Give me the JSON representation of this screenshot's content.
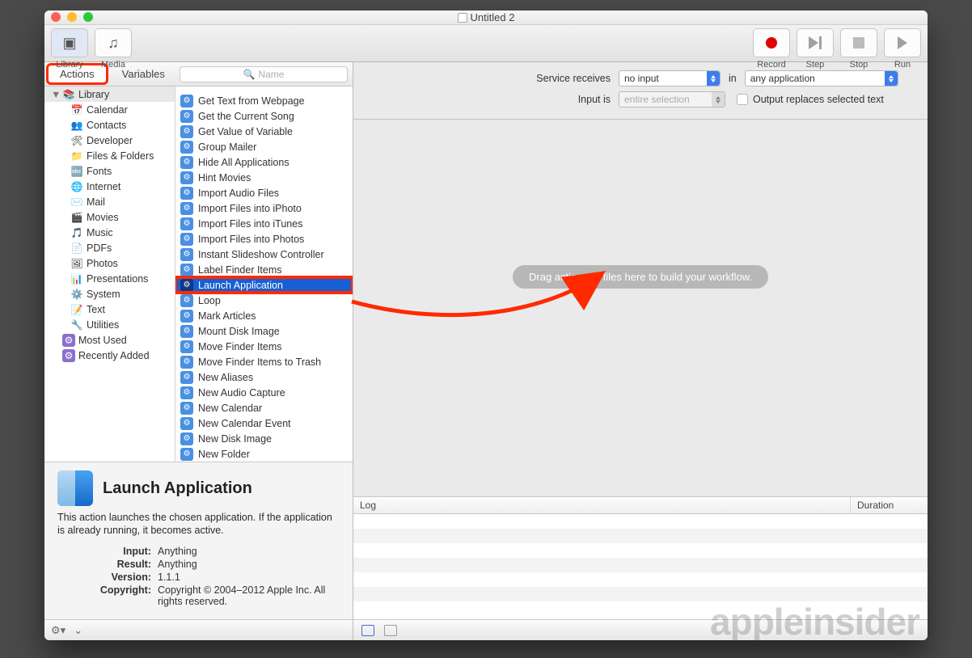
{
  "title": "Untitled 2",
  "toolbar": {
    "library": "Library",
    "media": "Media",
    "record": "Record",
    "step": "Step",
    "stop": "Stop",
    "run": "Run"
  },
  "tabs": {
    "actions": "Actions",
    "variables": "Variables"
  },
  "search": {
    "placeholder": "Name"
  },
  "categories": {
    "heading": "Library",
    "items": [
      "Calendar",
      "Contacts",
      "Developer",
      "Files & Folders",
      "Fonts",
      "Internet",
      "Mail",
      "Movies",
      "Music",
      "PDFs",
      "Photos",
      "Presentations",
      "System",
      "Text",
      "Utilities"
    ],
    "footer": [
      "Most Used",
      "Recently Added"
    ]
  },
  "actions": [
    "Get Text from Webpage",
    "Get the Current Song",
    "Get Value of Variable",
    "Group Mailer",
    "Hide All Applications",
    "Hint Movies",
    "Import Audio Files",
    "Import Files into iPhoto",
    "Import Files into iTunes",
    "Import Files into Photos",
    "Instant Slideshow Controller",
    "Label Finder Items",
    "Launch Application",
    "Loop",
    "Mark Articles",
    "Mount Disk Image",
    "Move Finder Items",
    "Move Finder Items to Trash",
    "New Aliases",
    "New Audio Capture",
    "New Calendar",
    "New Calendar Event",
    "New Disk Image",
    "New Folder"
  ],
  "selected_action_index": 12,
  "info": {
    "title": "Launch Application",
    "desc": "This action launches the chosen application. If the application is already running, it becomes active.",
    "rows": [
      {
        "k": "Input:",
        "v": "Anything"
      },
      {
        "k": "Result:",
        "v": "Anything"
      },
      {
        "k": "Version:",
        "v": "1.1.1"
      },
      {
        "k": "Copyright:",
        "v": "Copyright © 2004–2012 Apple Inc.  All rights reserved."
      }
    ]
  },
  "params": {
    "label1": "Service receives",
    "sel1": "no input",
    "in": "in",
    "sel2": "any application",
    "label2": "Input is",
    "sel3": "entire selection",
    "chk_label": "Output replaces selected text"
  },
  "canvas_hint": "Drag actions or files here to build your workflow.",
  "log": {
    "c1": "Log",
    "c2": "Duration"
  },
  "watermark": "appleinsider"
}
